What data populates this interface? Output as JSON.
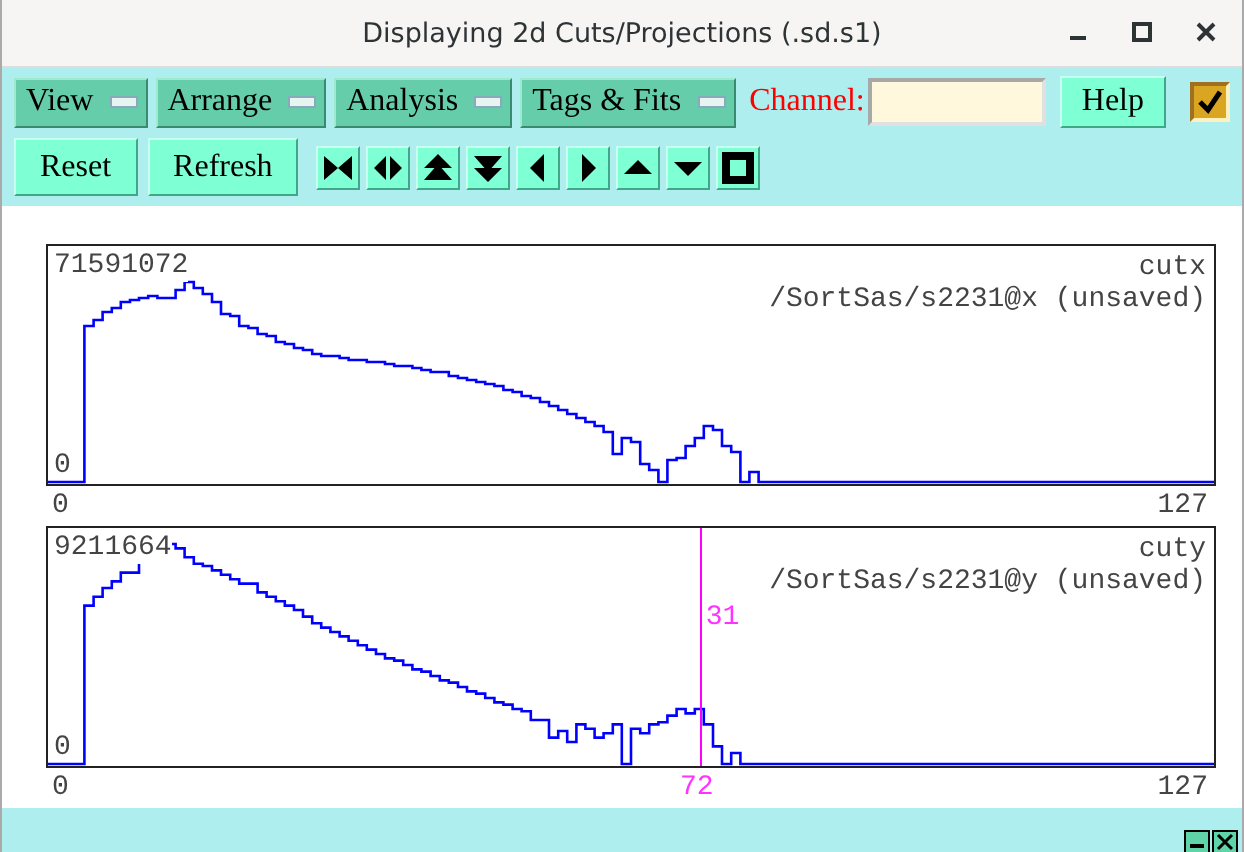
{
  "window": {
    "title": "Displaying 2d Cuts/Projections (.sd.s1)"
  },
  "menus": [
    {
      "label": "View"
    },
    {
      "label": "Arrange"
    },
    {
      "label": "Analysis"
    },
    {
      "label": "Tags & Fits"
    }
  ],
  "channel": {
    "label": "Channel:"
  },
  "help_button": "Help",
  "toggle": {
    "checked": true
  },
  "buttons": [
    "Reset",
    "Refresh"
  ],
  "plots": [
    {
      "max_label": "71591072",
      "min_label": "0",
      "name": "cutx",
      "source": "/SortSas/s2231@x (unsaved)",
      "x_start": "0",
      "x_end": "127"
    },
    {
      "max_label": "9211664",
      "min_label": "0",
      "name": "cuty",
      "source": "/SortSas/s2231@y (unsaved)",
      "x_start": "0",
      "x_end": "127",
      "cursor": {
        "level": 0.559,
        "x_label": "72",
        "y_label": "31"
      }
    }
  ]
}
